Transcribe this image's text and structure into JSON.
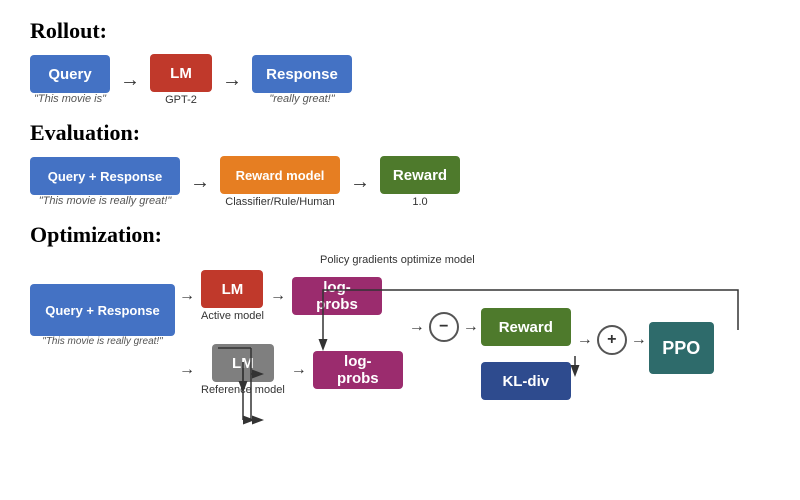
{
  "sections": {
    "rollout": {
      "title": "Rollout:",
      "query_label": "Query",
      "lm_label": "LM",
      "response_label": "Response",
      "query_subtext": "\"This movie is\"",
      "lm_subtext": "GPT-2",
      "response_subtext": "\"really great!\""
    },
    "evaluation": {
      "title": "Evaluation:",
      "query_response_label": "Query + Response",
      "reward_model_label": "Reward model",
      "reward_label": "Reward",
      "query_response_subtext": "\"This movie is really great!\"",
      "reward_model_subtext": "Classifier/Rule/Human",
      "reward_subtext": "1.0"
    },
    "optimization": {
      "title": "Optimization:",
      "query_response_label": "Query + Response",
      "query_response_subtext": "\"This movie is really great!\"",
      "lm_active_label": "LM",
      "lm_active_subtext": "Active model",
      "lm_ref_label": "LM",
      "lm_ref_subtext": "Reference model",
      "logprobs_top_label": "log-probs",
      "logprobs_bot_label": "log-probs",
      "reward_label": "Reward",
      "kldiv_label": "KL-div",
      "plus_label": "+",
      "minus_label": "-",
      "ppo_label": "PPO",
      "policy_gradient_label": "Policy gradients optimize model"
    }
  }
}
